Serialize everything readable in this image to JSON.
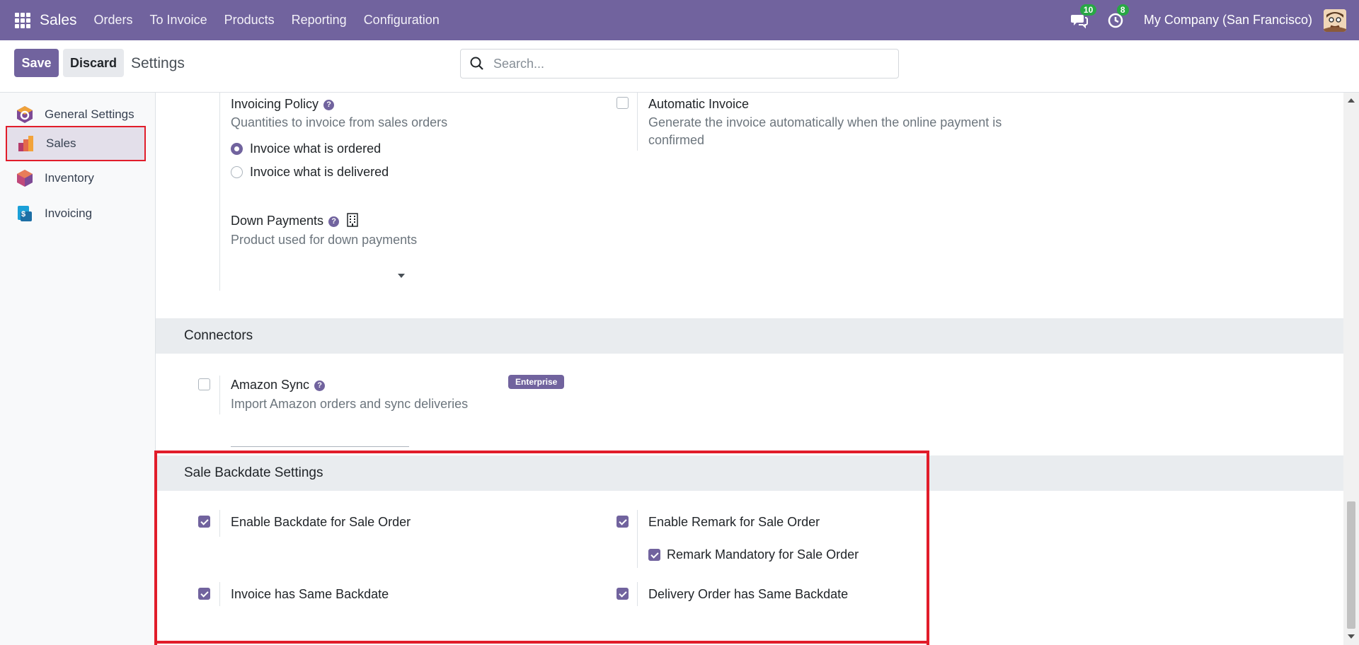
{
  "navbar": {
    "app_name": "Sales",
    "menu": [
      "Orders",
      "To Invoice",
      "Products",
      "Reporting",
      "Configuration"
    ],
    "messages_count": "10",
    "activities_count": "8",
    "company": "My Company (San Francisco)"
  },
  "control": {
    "save_label": "Save",
    "discard_label": "Discard",
    "breadcrumb": "Settings",
    "search_placeholder": "Search..."
  },
  "sidebar": {
    "items": [
      {
        "label": "General Settings",
        "icon": "odoo-icon"
      },
      {
        "label": "Sales",
        "icon": "sales-icon",
        "active": true
      },
      {
        "label": "Inventory",
        "icon": "inventory-icon"
      },
      {
        "label": "Invoicing",
        "icon": "invoicing-icon"
      }
    ]
  },
  "invoicing_policy": {
    "title": "Invoicing Policy",
    "description": "Quantities to invoice from sales orders",
    "options": [
      "Invoice what is ordered",
      "Invoice what is delivered"
    ],
    "selected_index": 0
  },
  "automatic_invoice": {
    "title": "Automatic Invoice",
    "description_line1": "Generate the invoice automatically when the online payment is",
    "description_line2": "confirmed",
    "checked": false
  },
  "down_payments": {
    "title": "Down Payments",
    "description": "Product used for down payments",
    "value": ""
  },
  "connectors": {
    "section_title": "Connectors",
    "amazon_title": "Amazon Sync",
    "amazon_description": "Import Amazon orders and sync deliveries",
    "badge": "Enterprise",
    "checked": false
  },
  "backdate": {
    "section_title": "Sale Backdate Settings",
    "enable_backdate": "Enable Backdate for Sale Order",
    "enable_remark": "Enable Remark for Sale Order",
    "remark_mandatory": "Remark Mandatory for Sale Order",
    "invoice_same_backdate": "Invoice has Same Backdate",
    "delivery_same_backdate": "Delivery Order has Same Backdate"
  },
  "colors": {
    "brand": "#71639e",
    "highlight": "#e11d2a",
    "badge_green": "#28a745"
  }
}
